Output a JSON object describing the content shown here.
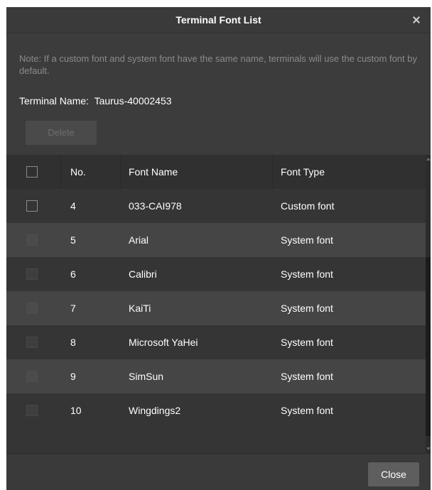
{
  "dialog": {
    "title": "Terminal Font List",
    "note": "Note: If a custom font and system font have the same name, terminals will use the custom font by default.",
    "terminal_label": "Terminal Name:",
    "terminal_name": "Taurus-40002453",
    "delete_label": "Delete",
    "close_label": "Close"
  },
  "table": {
    "columns": [
      "No.",
      "Font Name",
      "Font Type"
    ],
    "rows": [
      {
        "no": "4",
        "name": "033-CAI978",
        "type": "Custom font",
        "checkbox_enabled": true
      },
      {
        "no": "5",
        "name": "Arial",
        "type": "System font",
        "checkbox_enabled": false
      },
      {
        "no": "6",
        "name": "Calibri",
        "type": "System font",
        "checkbox_enabled": false
      },
      {
        "no": "7",
        "name": "KaiTi",
        "type": "System font",
        "checkbox_enabled": false
      },
      {
        "no": "8",
        "name": "Microsoft YaHei",
        "type": "System font",
        "checkbox_enabled": false
      },
      {
        "no": "9",
        "name": "SimSun",
        "type": "System font",
        "checkbox_enabled": false
      },
      {
        "no": "10",
        "name": "Wingdings2",
        "type": "System font",
        "checkbox_enabled": false
      }
    ]
  },
  "icons": {
    "close": "close-icon",
    "scroll_up": "arrow-up-icon",
    "scroll_down": "arrow-down-icon"
  },
  "colors": {
    "dialog_bg": "#3c3c3c",
    "row_alt": "#454545",
    "note_text": "#8b8b8b",
    "button_bg": "#5e5e5e"
  }
}
